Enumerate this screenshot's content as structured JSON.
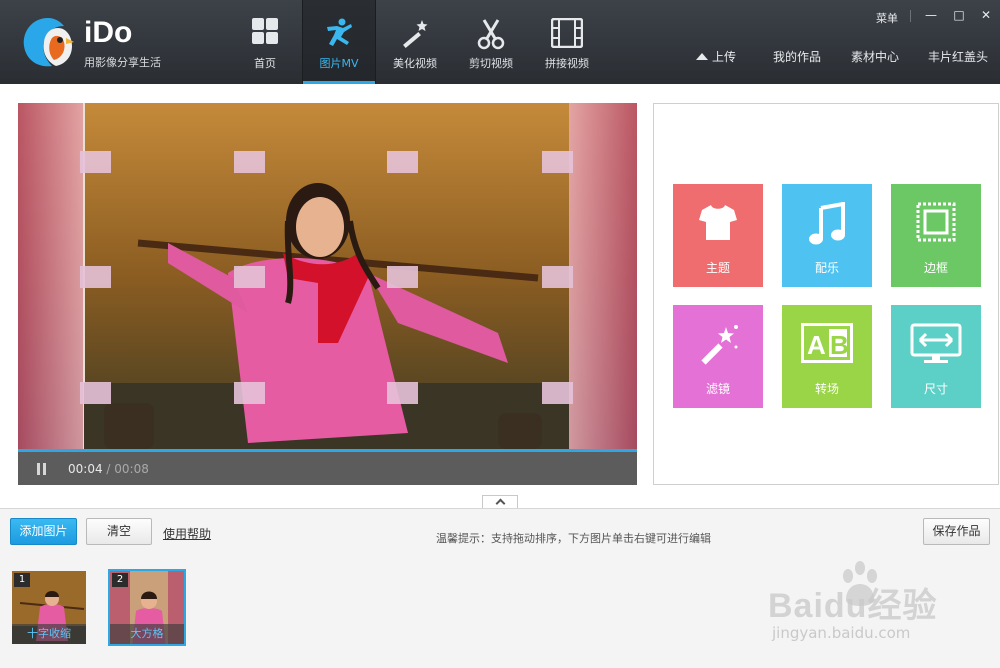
{
  "app": {
    "brand": "iDo",
    "slogan": "用影像分享生活"
  },
  "nav": {
    "tabs": [
      {
        "label": "首页",
        "icon": "home-grid-icon"
      },
      {
        "label": "图片MV",
        "icon": "running-figure-icon",
        "active": true
      },
      {
        "label": "美化视频",
        "icon": "magic-wand-icon"
      },
      {
        "label": "剪切视频",
        "icon": "scissors-icon"
      },
      {
        "label": "拼接视频",
        "icon": "film-strip-icon"
      }
    ]
  },
  "window": {
    "menu_label": "菜单",
    "minimize": "—",
    "maximize": "□",
    "close": "✕"
  },
  "header_links": {
    "upload": "上传",
    "my_works": "我的作品",
    "material_center": "素材中心",
    "user": "丰片红盖头"
  },
  "player": {
    "current_time": "00:04",
    "separator": " / ",
    "total_time": "00:08",
    "progress_fraction": 0.5
  },
  "tools": [
    {
      "label": "主题",
      "icon": "tshirt-icon",
      "color": "#ef6d6e"
    },
    {
      "label": "配乐",
      "icon": "music-note-icon",
      "color": "#4ec3f2"
    },
    {
      "label": "边框",
      "icon": "frame-icon",
      "color": "#6cc865"
    },
    {
      "label": "滤镜",
      "icon": "magic-wand-icon",
      "color": "#e472d6"
    },
    {
      "label": "转场",
      "icon": "ab-transition-icon",
      "color": "#9ad447"
    },
    {
      "label": "尺寸",
      "icon": "monitor-resize-icon",
      "color": "#5cd0c7"
    }
  ],
  "bottom": {
    "add_photo": "添加图片",
    "clear": "清空",
    "help": "使用帮助",
    "tip": "温馨提示：支持拖动排序，下方图片单击右键可进行编辑",
    "save": "保存作品"
  },
  "thumbnails": [
    {
      "num": "1",
      "label": "十字收缩",
      "selected": false
    },
    {
      "num": "2",
      "label": "大方格",
      "selected": true
    }
  ],
  "watermark": {
    "text": "Baidu经验",
    "url": "jingyan.baidu.com"
  },
  "colors": {
    "accent": "#2ea8e5",
    "header_bg": "#34393f"
  }
}
